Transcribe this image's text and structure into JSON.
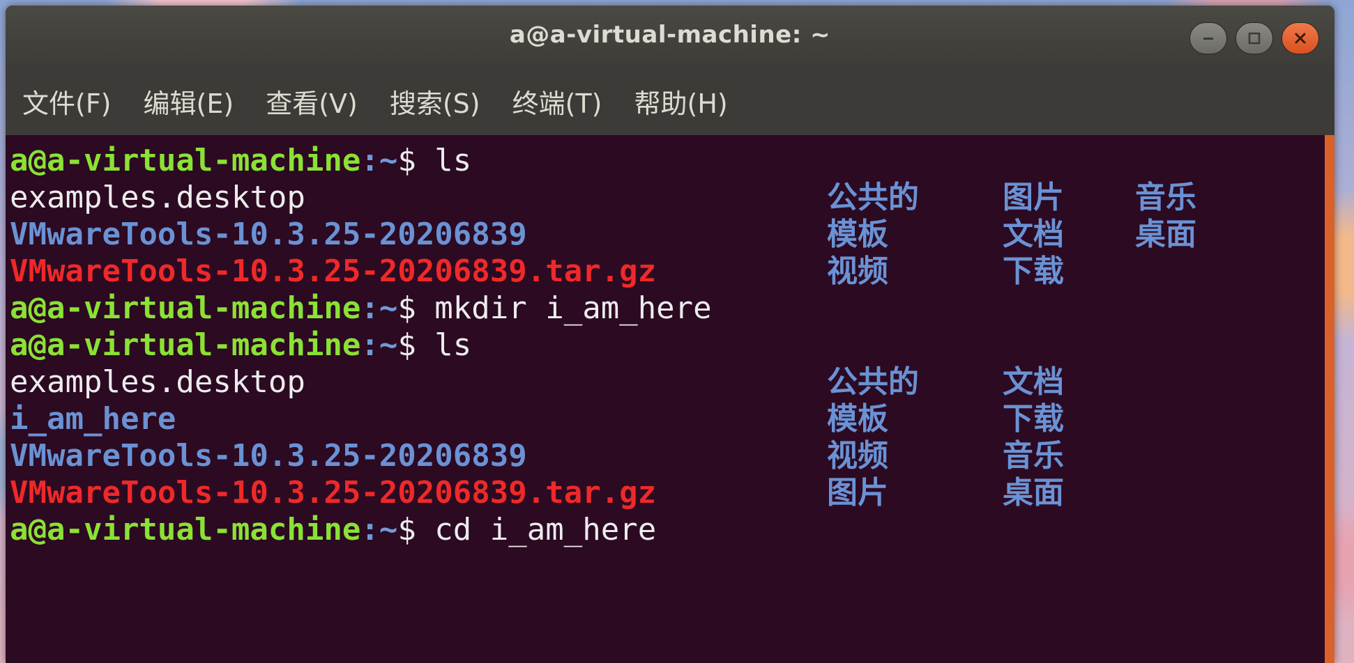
{
  "window": {
    "title": "a@a-virtual-machine: ~"
  },
  "menu": [
    "文件(F)",
    "编辑(E)",
    "查看(V)",
    "搜索(S)",
    "终端(T)",
    "帮助(H)"
  ],
  "prompt": {
    "user_host": "a@a-virtual-machine",
    "path": ":~",
    "sign": "$ "
  },
  "commands": [
    "ls",
    "mkdir i_am_here",
    "ls",
    "cd i_am_here"
  ],
  "ls1": {
    "row1": {
      "c1": "examples.desktop",
      "c2": "公共的",
      "c3": "图片",
      "c4": "音乐"
    },
    "row2": {
      "c1": "VMwareTools-10.3.25-20206839",
      "c2": "模板",
      "c3": "文档",
      "c4": "桌面"
    },
    "row3": {
      "c1": "VMwareTools-10.3.25-20206839.tar.gz",
      "c2": "视频",
      "c3": "下载"
    }
  },
  "ls2": {
    "row1": {
      "c1": "examples.desktop",
      "c2": "公共的",
      "c3": "文档"
    },
    "row2": {
      "c1": "i_am_here",
      "c2": "模板",
      "c3": "下载"
    },
    "row3": {
      "c1": "VMwareTools-10.3.25-20206839",
      "c2": "视频",
      "c3": "音乐"
    },
    "row4": {
      "c1": "VMwareTools-10.3.25-20206839.tar.gz",
      "c2": "图片",
      "c3": "桌面"
    }
  },
  "colors": {
    "background": "#2c0a22",
    "prompt_user": "#8ae234",
    "directory": "#6a92d4",
    "archive": "#ef2929",
    "text": "#ececec",
    "close_button": "#e25a26"
  },
  "icons": {
    "minimize": "minimize-icon",
    "maximize": "maximize-icon",
    "close": "close-icon"
  }
}
